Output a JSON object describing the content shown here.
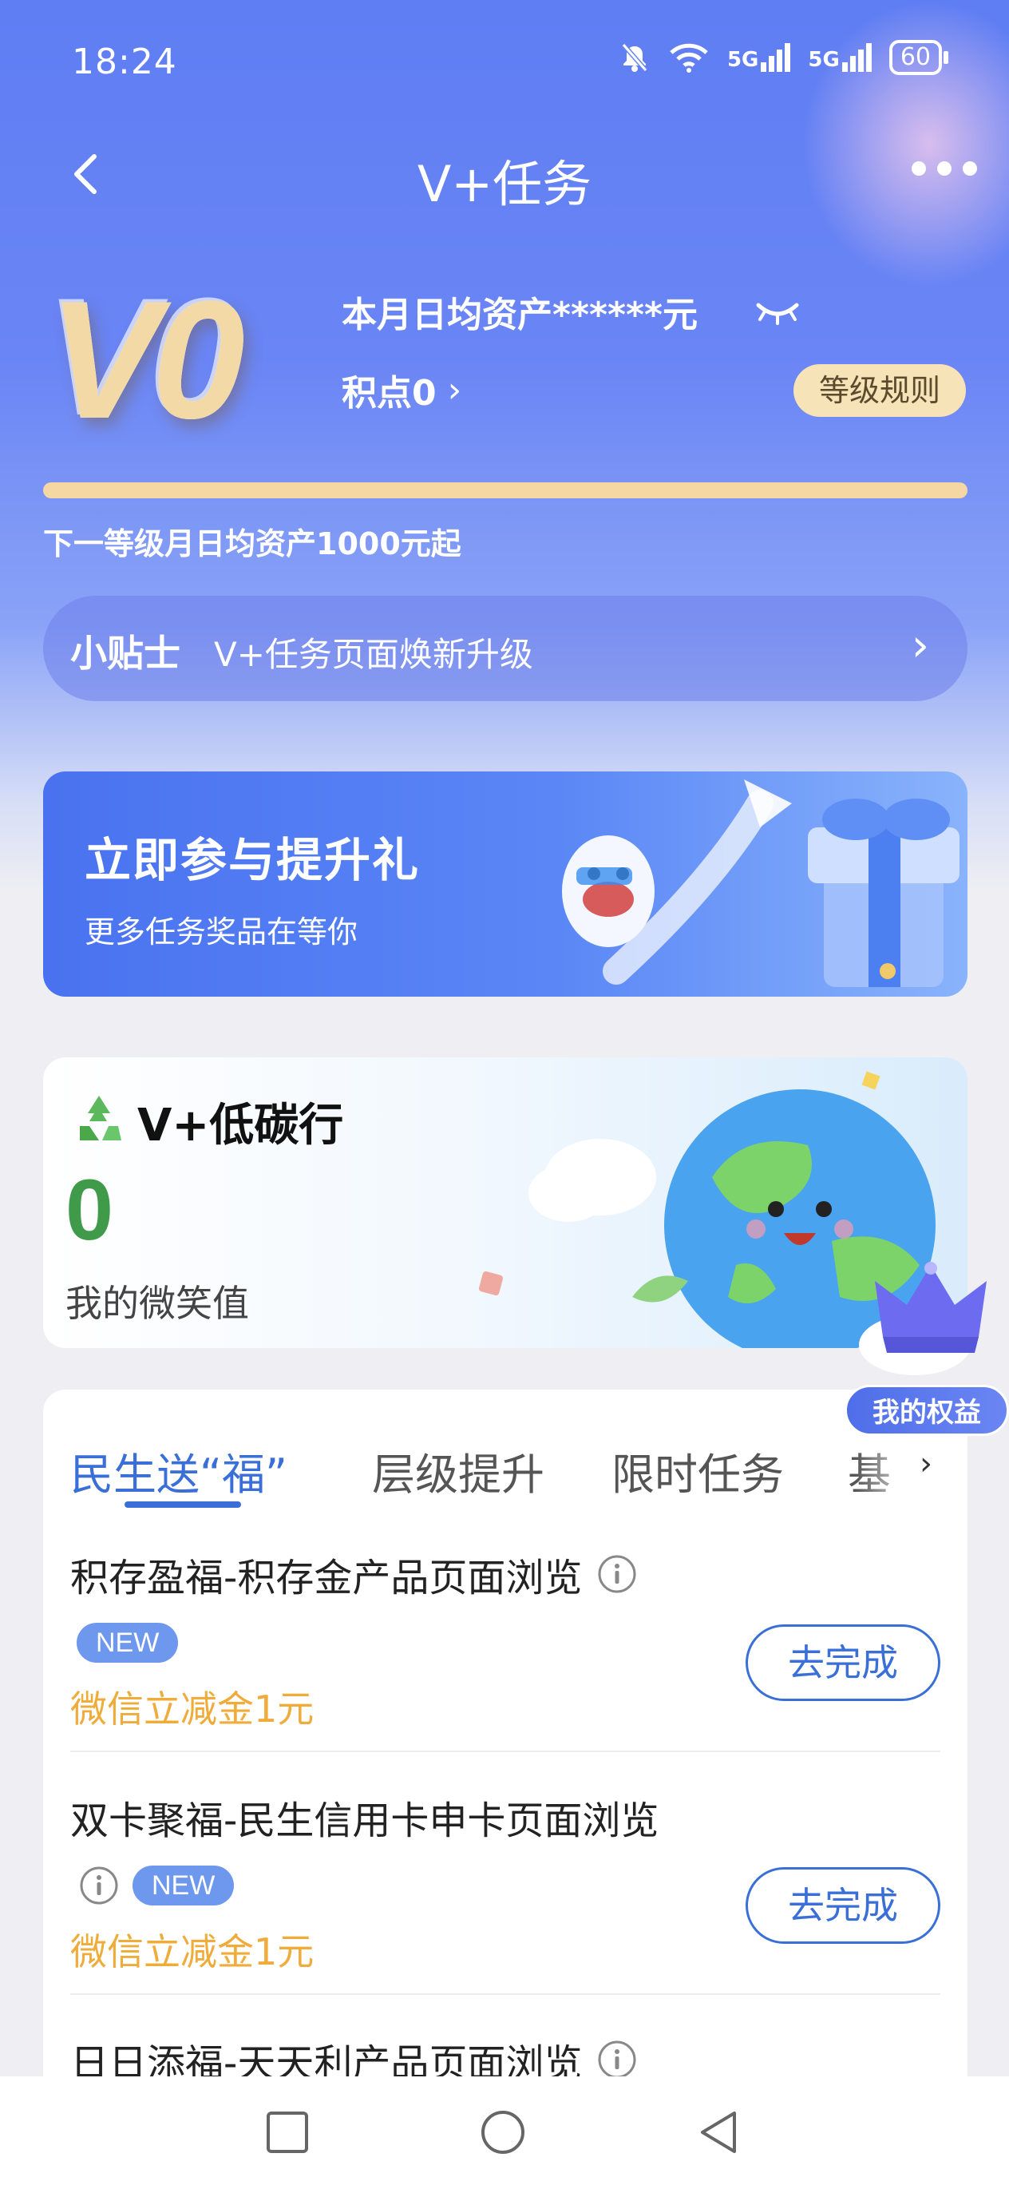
{
  "status_bar": {
    "time": "18:24",
    "network_1": "5G",
    "network_2": "5G",
    "battery": "60"
  },
  "nav": {
    "title": "V+任务"
  },
  "level": {
    "badge": "V0",
    "monthly_avg_asset": "本月日均资产******元",
    "points": "积点0",
    "level_rules_button": "等级规则",
    "progress": 1.0,
    "next_level_hint": "下一等级月日均资产1000元起"
  },
  "tips": {
    "label": "小贴士",
    "text": "V+任务页面焕新升级"
  },
  "promo": {
    "title": "立即参与提升礼",
    "subtitle": "更多任务奖品在等你"
  },
  "low_carbon": {
    "title": "V+低碳行",
    "value": "0",
    "value_label": "我的微笑值"
  },
  "rights_badge": "我的权益",
  "tabs": [
    {
      "label": "民生送“福”",
      "active": true
    },
    {
      "label": "层级提升",
      "active": false
    },
    {
      "label": "限时任务",
      "active": false
    },
    {
      "label": "基",
      "active": false
    }
  ],
  "tasks": [
    {
      "title": "积存盈福-积存金产品页面浏览",
      "tag": "NEW",
      "reward": "微信立减金1元",
      "button": "去完成"
    },
    {
      "title": "双卡聚福-民生信用卡申卡页面浏览",
      "tag": "NEW",
      "reward": "微信立减金1元",
      "button": "去完成"
    },
    {
      "title": "日日添福-天天利产品页面浏览"
    }
  ],
  "colors": {
    "accent": "#3a6fd8",
    "reward": "#f0ac3a",
    "carbon_value": "#3f9a4a",
    "level_rules_bg": "#f7e3b8"
  }
}
